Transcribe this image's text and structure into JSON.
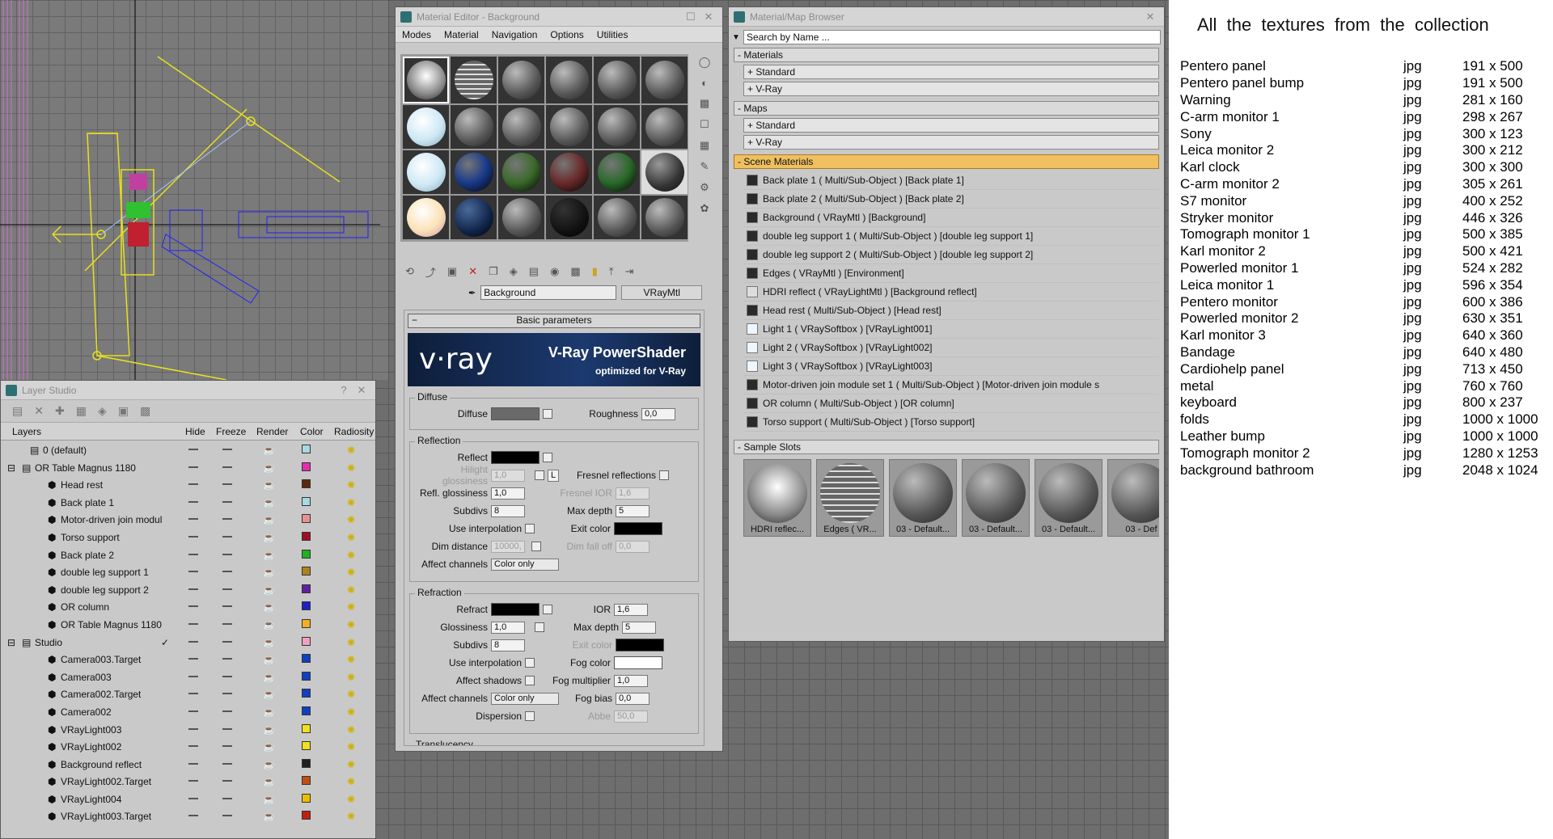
{
  "layer_studio": {
    "title": "Layer Studio",
    "help": "?",
    "close": "✕",
    "columns": [
      "Layers",
      "Hide",
      "Freeze",
      "Render",
      "Color",
      "Radiosity"
    ],
    "rows": [
      {
        "name": "0 (default)",
        "indent": 1,
        "color": "#a8d8e0",
        "type": "layer"
      },
      {
        "name": "OR Table Magnus 1180",
        "indent": 0,
        "color": "#e030b0",
        "type": "layer",
        "expand": "⊟"
      },
      {
        "name": "Head rest",
        "indent": 2,
        "color": "#5a2a10",
        "type": "obj"
      },
      {
        "name": "Back plate 1",
        "indent": 2,
        "color": "#a8d8e0",
        "type": "obj"
      },
      {
        "name": "Motor-driven join modul",
        "indent": 2,
        "color": "#e89090",
        "type": "obj"
      },
      {
        "name": "Torso support",
        "indent": 2,
        "color": "#a01020",
        "type": "obj"
      },
      {
        "name": "Back plate 2",
        "indent": 2,
        "color": "#20b020",
        "type": "obj"
      },
      {
        "name": "double leg support 1",
        "indent": 2,
        "color": "#b08020",
        "type": "obj"
      },
      {
        "name": "double leg support 2",
        "indent": 2,
        "color": "#6020a0",
        "type": "obj"
      },
      {
        "name": "OR column",
        "indent": 2,
        "color": "#2020c0",
        "type": "obj"
      },
      {
        "name": "OR Table Magnus 1180",
        "indent": 2,
        "color": "#f0b020",
        "type": "obj"
      },
      {
        "name": "Studio",
        "indent": 0,
        "color": "#f0a0c0",
        "type": "layer",
        "expand": "⊟",
        "check": "✓"
      },
      {
        "name": "Camera003.Target",
        "indent": 2,
        "color": "#1040c0",
        "type": "obj"
      },
      {
        "name": "Camera003",
        "indent": 2,
        "color": "#1040c0",
        "type": "obj"
      },
      {
        "name": "Camera002.Target",
        "indent": 2,
        "color": "#1040c0",
        "type": "obj"
      },
      {
        "name": "Camera002",
        "indent": 2,
        "color": "#1040c0",
        "type": "obj"
      },
      {
        "name": "VRayLight003",
        "indent": 2,
        "color": "#f0e020",
        "type": "obj"
      },
      {
        "name": "VRayLight002",
        "indent": 2,
        "color": "#f0e020",
        "type": "obj"
      },
      {
        "name": "Background reflect",
        "indent": 2,
        "color": "#202020",
        "type": "obj"
      },
      {
        "name": "VRayLight002.Target",
        "indent": 2,
        "color": "#c05010",
        "type": "obj"
      },
      {
        "name": "VRayLight004",
        "indent": 2,
        "color": "#e8c000",
        "type": "obj"
      },
      {
        "name": "VRayLight003.Target",
        "indent": 2,
        "color": "#c02010",
        "type": "obj"
      }
    ]
  },
  "material_editor": {
    "title": "Material Editor - Background",
    "menu": [
      "Modes",
      "Material",
      "Navigation",
      "Options",
      "Utilities"
    ],
    "material_name": "Background",
    "material_type": "VRayMtl",
    "rollout_title": "Basic parameters",
    "banner_logo": "v·ray",
    "banner_title": "V-Ray PowerShader",
    "banner_sub": "optimized for V-Ray",
    "diffuse": {
      "group": "Diffuse",
      "diffuse_label": "Diffuse",
      "roughness_label": "Roughness",
      "roughness": "0,0"
    },
    "reflection": {
      "group": "Reflection",
      "reflect_label": "Reflect",
      "hilight_label": "Hilight glossiness",
      "hilight": "1,0",
      "fresnel_label": "Fresnel reflections",
      "lock": "L",
      "refl_gloss_label": "Refl. glossiness",
      "refl_gloss": "1,0",
      "fresnel_ior_label": "Fresnel IOR",
      "fresnel_ior": "1,6",
      "subdivs_label": "Subdivs",
      "subdivs": "8",
      "max_depth_label": "Max depth",
      "max_depth": "5",
      "use_interp_label": "Use interpolation",
      "exit_color_label": "Exit color",
      "dim_distance_label": "Dim distance",
      "dim_distance": "10000,",
      "dim_falloff_label": "Dim fall off",
      "dim_falloff": "0,0",
      "affect_channels_label": "Affect channels",
      "affect_channels": "Color only"
    },
    "refraction": {
      "group": "Refraction",
      "refract_label": "Refract",
      "ior_label": "IOR",
      "ior": "1,6",
      "glossiness_label": "Glossiness",
      "glossiness": "1,0",
      "max_depth_label": "Max depth",
      "max_depth": "5",
      "subdivs_label": "Subdivs",
      "subdivs": "8",
      "exit_color_label": "Exit color",
      "use_interp_label": "Use interpolation",
      "fog_color_label": "Fog color",
      "affect_shadows_label": "Affect shadows",
      "fog_mult_label": "Fog multiplier",
      "fog_mult": "1,0",
      "affect_channels_label": "Affect channels",
      "affect_channels": "Color only",
      "fog_bias_label": "Fog bias",
      "fog_bias": "0,0",
      "dispersion_label": "Dispersion",
      "abbe_label": "Abbe",
      "abbe": "50,0"
    },
    "translucency_label": "Translucency"
  },
  "material_browser": {
    "title": "Material/Map Browser",
    "search_placeholder": "Search by Name ...",
    "materials_header": "- Materials",
    "maps_header": "- Maps",
    "standard": "+ Standard",
    "vray": "+ V-Ray",
    "scene_header": "- Scene Materials",
    "scene_items": [
      "Back plate 1  ( Multi/Sub-Object )  [Back plate 1]",
      "Back plate 2  ( Multi/Sub-Object )  [Back plate 2]",
      "Background  ( VRayMtl )  [Background]",
      "double leg support 1  ( Multi/Sub-Object )  [double leg support 1]",
      "double leg support 2  ( Multi/Sub-Object )  [double leg support 2]",
      "Edges  ( VRayMtl )  [Environment]",
      "HDRI reflect  ( VRayLightMtl )  [Background reflect]",
      "Head rest  ( Multi/Sub-Object )  [Head rest]",
      "Light 1  ( VRaySoftbox )  [VRayLight001]",
      "Light 2  ( VRaySoftbox )  [VRayLight002]",
      "Light 3  ( VRaySoftbox )  [VRayLight003]",
      "Motor-driven join module set 1  ( Multi/Sub-Object )  [Motor-driven join module s",
      "OR column  ( Multi/Sub-Object )  [OR column]",
      "Torso support  ( Multi/Sub-Object )  [Torso support]"
    ],
    "sample_header": "- Sample Slots",
    "samples": [
      "HDRI reflec...",
      "Edges ( VR...",
      "03 - Default...",
      "03 - Default...",
      "03 - Default...",
      "03 - Def"
    ]
  },
  "textures": {
    "title": "All  the  textures  from  the  collection",
    "items": [
      {
        "name": "Pentero panel",
        "ext": "jpg",
        "size": "191 x 500"
      },
      {
        "name": "Pentero panel bump",
        "ext": "jpg",
        "size": "191 x 500"
      },
      {
        "name": "Warning",
        "ext": "jpg",
        "size": "281 x 160"
      },
      {
        "name": "C-arm monitor 1",
        "ext": "jpg",
        "size": "298 x 267"
      },
      {
        "name": "Sony",
        "ext": "jpg",
        "size": "300 x 123"
      },
      {
        "name": "Leica monitor 2",
        "ext": "jpg",
        "size": "300 x 212"
      },
      {
        "name": "Karl clock",
        "ext": "jpg",
        "size": "300 x 300"
      },
      {
        "name": "C-arm monitor 2",
        "ext": "jpg",
        "size": "305 x 261"
      },
      {
        "name": "S7 monitor",
        "ext": "jpg",
        "size": "400 x 252"
      },
      {
        "name": "Stryker monitor",
        "ext": "jpg",
        "size": "446 x 326"
      },
      {
        "name": "Tomograph monitor 1",
        "ext": "jpg",
        "size": "500 x 385"
      },
      {
        "name": "Karl monitor 2",
        "ext": "jpg",
        "size": "500 x 421"
      },
      {
        "name": "Powerled monitor 1",
        "ext": "jpg",
        "size": "524 x 282"
      },
      {
        "name": "Leica monitor 1",
        "ext": "jpg",
        "size": "596 x 354"
      },
      {
        "name": "Pentero monitor",
        "ext": "jpg",
        "size": "600 x 386"
      },
      {
        "name": "Powerled monitor 2",
        "ext": "jpg",
        "size": "630 x 351"
      },
      {
        "name": "Karl monitor 3",
        "ext": "jpg",
        "size": "640 x 360"
      },
      {
        "name": "Bandage",
        "ext": "jpg",
        "size": "640 x 480"
      },
      {
        "name": "Cardiohelp panel",
        "ext": "jpg",
        "size": "713 x 450"
      },
      {
        "name": "metal",
        "ext": "jpg",
        "size": "760 x 760"
      },
      {
        "name": "keyboard",
        "ext": "jpg",
        "size": "800 x 237"
      },
      {
        "name": "folds",
        "ext": "jpg",
        "size": "1000 x 1000"
      },
      {
        "name": "Leather bump",
        "ext": "jpg",
        "size": "1000 x 1000"
      },
      {
        "name": "Tomograph monitor 2",
        "ext": "jpg",
        "size": "1280 x 1253"
      },
      {
        "name": "background bathroom",
        "ext": "jpg",
        "size": "2048 x 1024"
      }
    ]
  }
}
